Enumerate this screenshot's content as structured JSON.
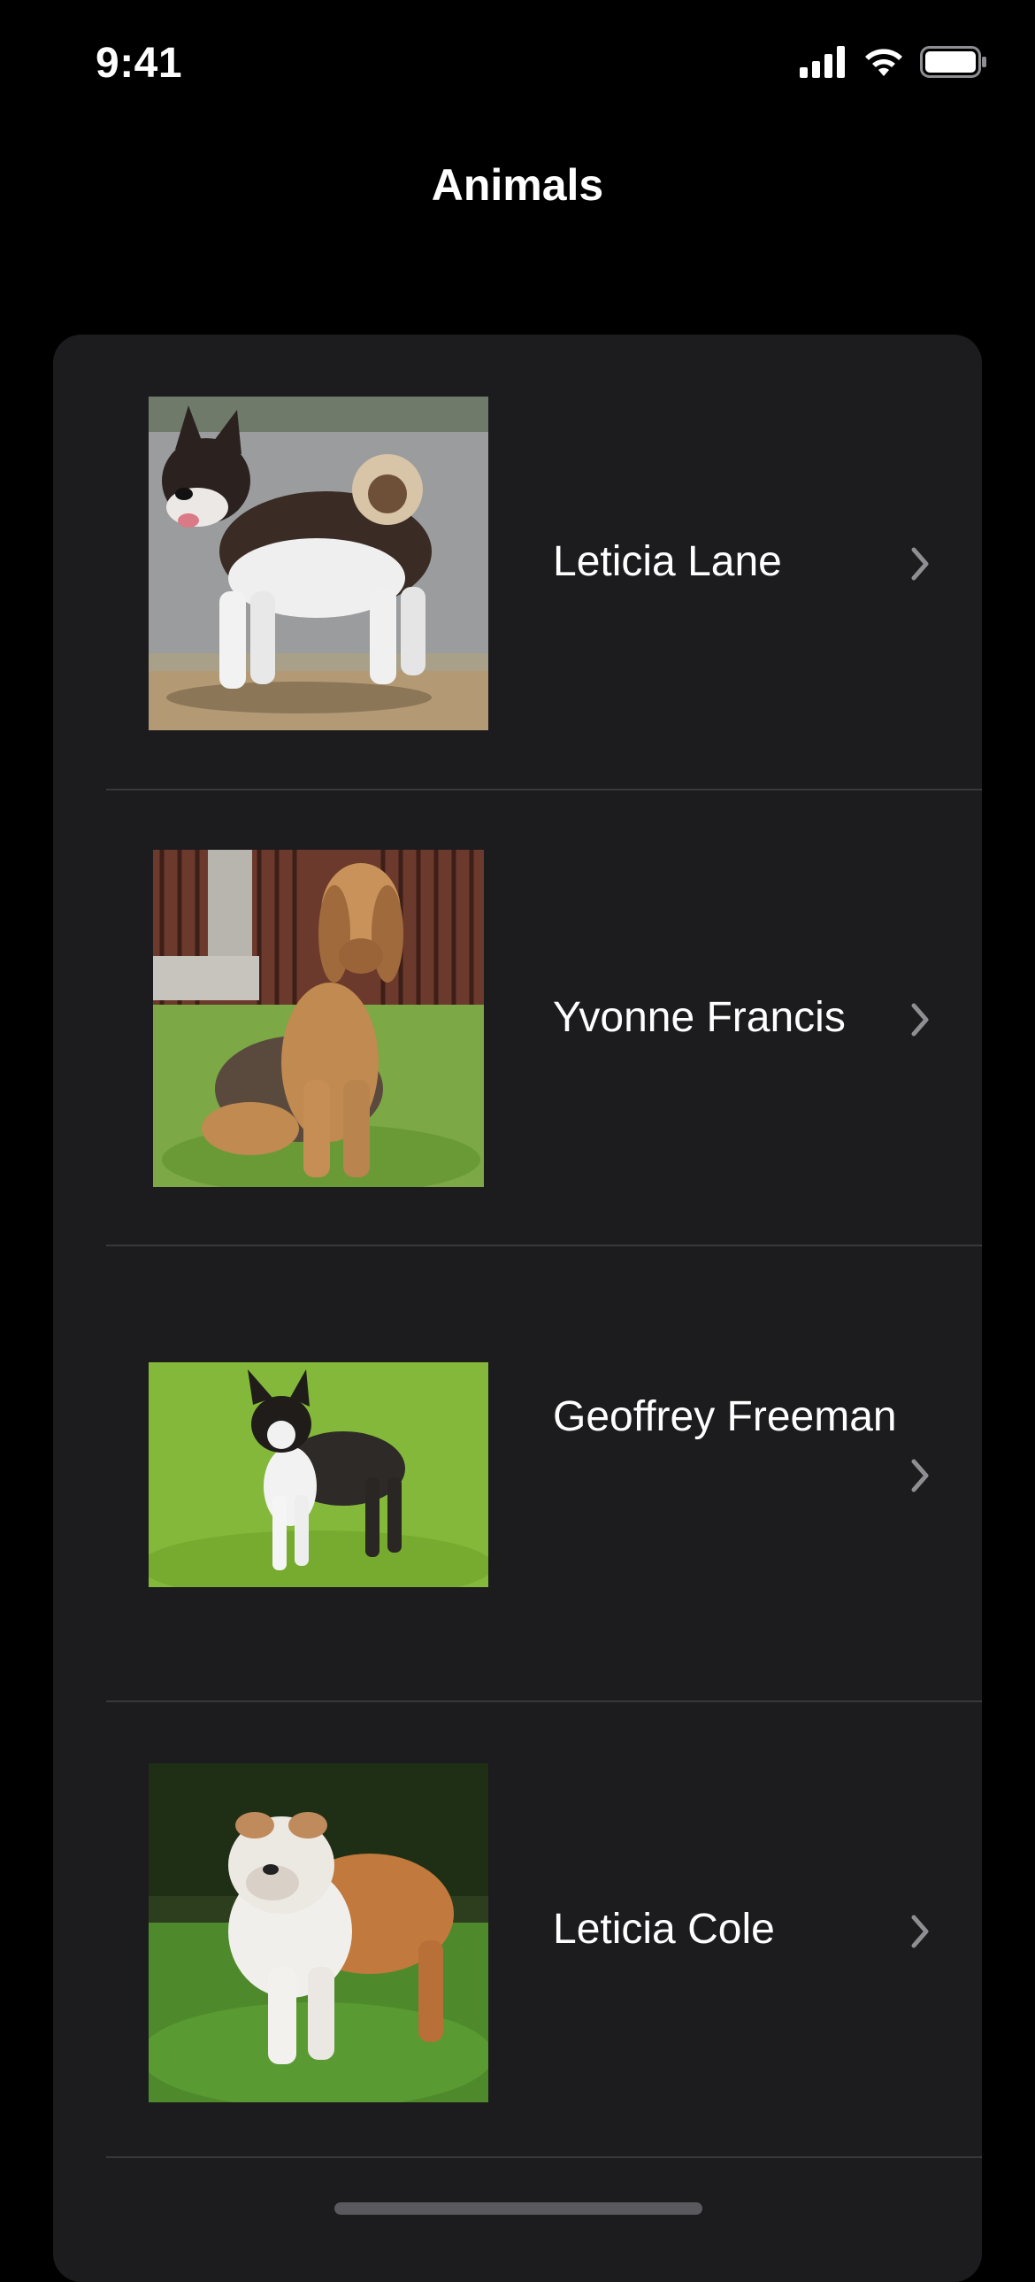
{
  "status_bar": {
    "time": "9:41",
    "icons": [
      "cellular-signal-icon",
      "wifi-icon",
      "battery-icon"
    ]
  },
  "nav": {
    "title": "Animals"
  },
  "list": {
    "items": [
      {
        "name": "Leticia Lane",
        "image": "akita-dog-photo",
        "chevron": "chevron-right-icon"
      },
      {
        "name": "Yvonne Francis",
        "image": "bloodhound-dog-photo",
        "chevron": "chevron-right-icon"
      },
      {
        "name": "Geoffrey Freeman",
        "image": "boston-terrier-dog-photo",
        "chevron": "chevron-right-icon"
      },
      {
        "name": "Leticia Cole",
        "image": "bulldog-dog-photo",
        "chevron": "chevron-right-icon"
      }
    ]
  },
  "colors": {
    "background": "#000000",
    "card": "#1c1c1e",
    "separator": "#38383a",
    "chevron": "#8e8e93",
    "text": "#ffffff"
  }
}
